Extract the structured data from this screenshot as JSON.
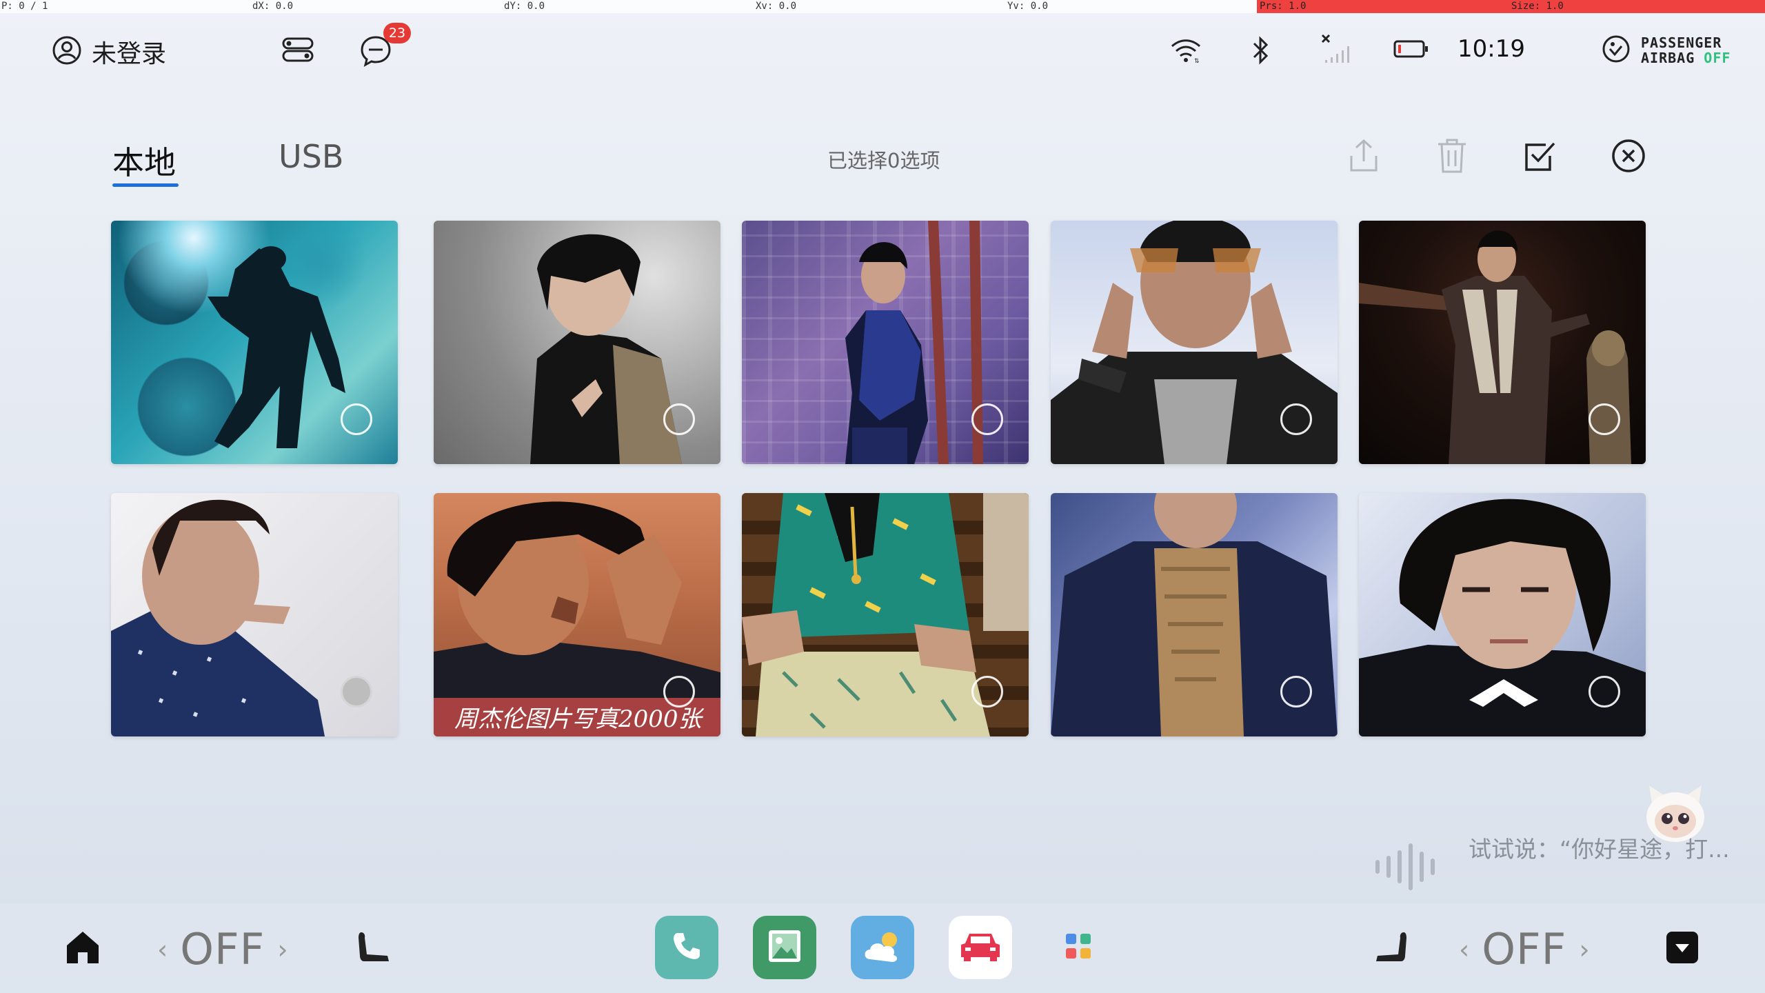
{
  "dev_overlay": {
    "pointer": "P: 0 / 1",
    "dx": "dX: 0.0",
    "dy": "dY: 0.0",
    "xv": "Xv: 0.0",
    "yv": "Yv: 0.0",
    "prs": "Prs: 1.0",
    "size": "Size: 1.0"
  },
  "status_bar": {
    "user_label": "未登录",
    "message_badge": "23",
    "time": "10:19",
    "airbag_line1": "PASSENGER",
    "airbag_line2": "AIRBAG",
    "airbag_state": "OFF",
    "icons": [
      "user-icon",
      "toggle-icon",
      "message-icon",
      "wifi-icon",
      "bluetooth-icon",
      "no-signal-icon",
      "battery-icon",
      "airbag-icon"
    ]
  },
  "gallery": {
    "tabs": [
      {
        "label": "本地",
        "active": true
      },
      {
        "label": "USB",
        "active": false
      }
    ],
    "selection_status": "已选择0选项",
    "toolbar_icons": [
      "share-icon",
      "delete-icon",
      "select-all-icon",
      "close-icon"
    ],
    "photos": [
      {
        "id": 1,
        "selected_marker": "empty"
      },
      {
        "id": 2,
        "selected_marker": "empty"
      },
      {
        "id": 3,
        "selected_marker": "empty"
      },
      {
        "id": 4,
        "selected_marker": "empty"
      },
      {
        "id": 5,
        "selected_marker": "empty"
      },
      {
        "id": 6,
        "selected_marker": "filled"
      },
      {
        "id": 7,
        "selected_marker": "empty",
        "watermark": "周杰伦图片写真2000张"
      },
      {
        "id": 8,
        "selected_marker": "empty"
      },
      {
        "id": 9,
        "selected_marker": "empty"
      },
      {
        "id": 10,
        "selected_marker": "empty"
      }
    ]
  },
  "voice": {
    "hint": "试试说：“你好星途，打..."
  },
  "dock": {
    "left_hvac": "OFF",
    "right_hvac": "OFF",
    "apps": [
      "phone-app",
      "gallery-app",
      "weather-app",
      "car-app",
      "apps-grid"
    ],
    "accent": "#5fb8b0"
  }
}
